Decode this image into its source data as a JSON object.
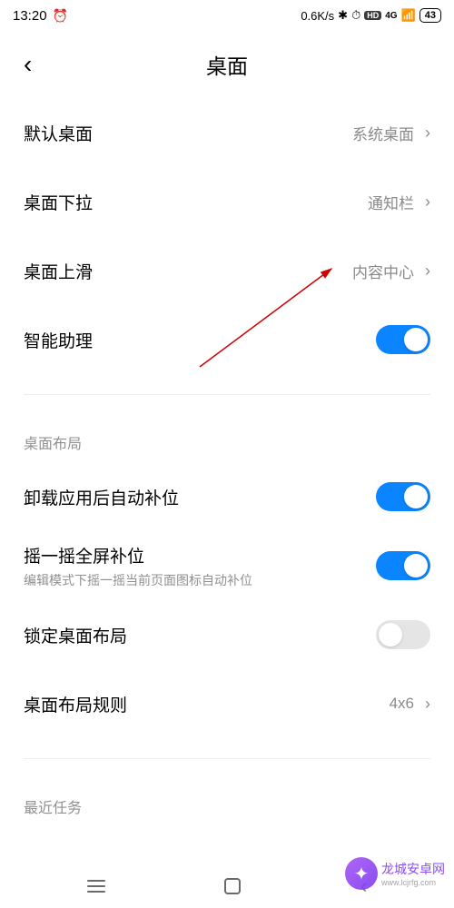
{
  "status": {
    "time": "13:20",
    "netspeed": "0.6K/s",
    "signal_label": "4G",
    "hd_label": "HD",
    "battery": "43"
  },
  "header": {
    "title": "桌面"
  },
  "rows": {
    "default_home": {
      "label": "默认桌面",
      "value": "系统桌面"
    },
    "pulldown": {
      "label": "桌面下拉",
      "value": "通知栏"
    },
    "swipeup": {
      "label": "桌面上滑",
      "value": "内容中心"
    },
    "assistant": {
      "label": "智能助理"
    },
    "autofill": {
      "label": "卸载应用后自动补位"
    },
    "shake": {
      "label": "摇一摇全屏补位",
      "sublabel": "编辑模式下摇一摇当前页面图标自动补位"
    },
    "lock": {
      "label": "锁定桌面布局"
    },
    "grid": {
      "label": "桌面布局规则",
      "value": "4x6"
    }
  },
  "sections": {
    "layout": "桌面布局",
    "recent": "最近任务"
  },
  "watermark": {
    "main": "龙城安卓网",
    "sub": "www.lcjrfg.com"
  }
}
